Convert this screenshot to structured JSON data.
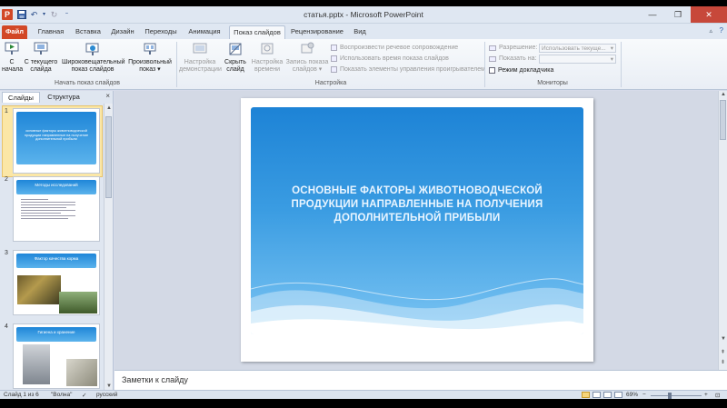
{
  "window": {
    "title": "статья.pptx - Microsoft PowerPoint",
    "app_icon_letter": "P",
    "qat_icons": [
      "save-icon",
      "undo-icon",
      "redo-icon",
      "customize-icon"
    ],
    "controls": [
      "minimize",
      "restore",
      "close"
    ]
  },
  "ribbon_tabs": [
    {
      "label": "Файл",
      "kind": "file"
    },
    {
      "label": "Главная"
    },
    {
      "label": "Вставка"
    },
    {
      "label": "Дизайн"
    },
    {
      "label": "Переходы"
    },
    {
      "label": "Анимация"
    },
    {
      "label": "Показ слайдов",
      "active": true
    },
    {
      "label": "Рецензирование"
    },
    {
      "label": "Вид"
    }
  ],
  "ribbon": {
    "start_group": {
      "label": "Начать показ слайдов",
      "buttons": [
        {
          "line1": "С",
          "line2": "начала"
        },
        {
          "line1": "С текущего",
          "line2": "слайда"
        },
        {
          "line1": "Широковещательный",
          "line2": "показ слайдов"
        },
        {
          "line1": "Произвольный",
          "line2": "показ ▾"
        }
      ]
    },
    "setup_group": {
      "label": "Настройка",
      "buttons": [
        {
          "line1": "Настройка",
          "line2": "демонстрации"
        },
        {
          "line1": "Скрыть",
          "line2": "слайд"
        },
        {
          "line1": "Настройка",
          "line2": "времени"
        },
        {
          "line1": "Запись показа",
          "line2": "слайдов ▾"
        }
      ],
      "checkboxes": [
        "Воспроизвести речевое сопровождение",
        "Использовать время показа слайдов",
        "Показать элементы управления проигрывателем"
      ]
    },
    "monitors_group": {
      "label": "Мониторы",
      "resolution_label": "Разрешение:",
      "resolution_value": "Использовать текуще...",
      "show_on_label": "Показать на:",
      "show_on_value": "",
      "presenter_view_label": "Режим докладчика"
    }
  },
  "left_panel": {
    "tabs": [
      "Слайды",
      "Структура"
    ],
    "close_glyph": "×",
    "thumbnails": [
      {
        "number": "1",
        "title": "основные факторы животноводческой продукции направленные на получение дополнительной прибыли"
      },
      {
        "number": "2",
        "title": "Методы исследований"
      },
      {
        "number": "3",
        "title": "Фактор качества корма"
      },
      {
        "number": "4",
        "title": "Гигиена и хранение"
      }
    ]
  },
  "slide": {
    "title": "ОСНОВНЫЕ ФАКТОРЫ ЖИВОТНОВОДЧЕСКОЙ ПРОДУКЦИИ НАПРАВЛЕННЫЕ НА ПОЛУЧЕНИЯ ДОПОЛНИТЕЛЬНОЙ ПРИБЫЛИ",
    "colors": {
      "top": "#1d83d6",
      "bottom": "#7cc5f3"
    }
  },
  "notes": {
    "placeholder": "Заметки к слайду"
  },
  "status_bar": {
    "slide_info": "Слайд 1 из 6",
    "theme": "\"Волна\"",
    "language": "русский",
    "zoom": "69%",
    "zoom_minus": "−",
    "zoom_plus": "+"
  },
  "colors": {
    "accent_file_tab": "#d24726",
    "ribbon_bg": "#f8fafc",
    "selection": "#f5c94a"
  }
}
